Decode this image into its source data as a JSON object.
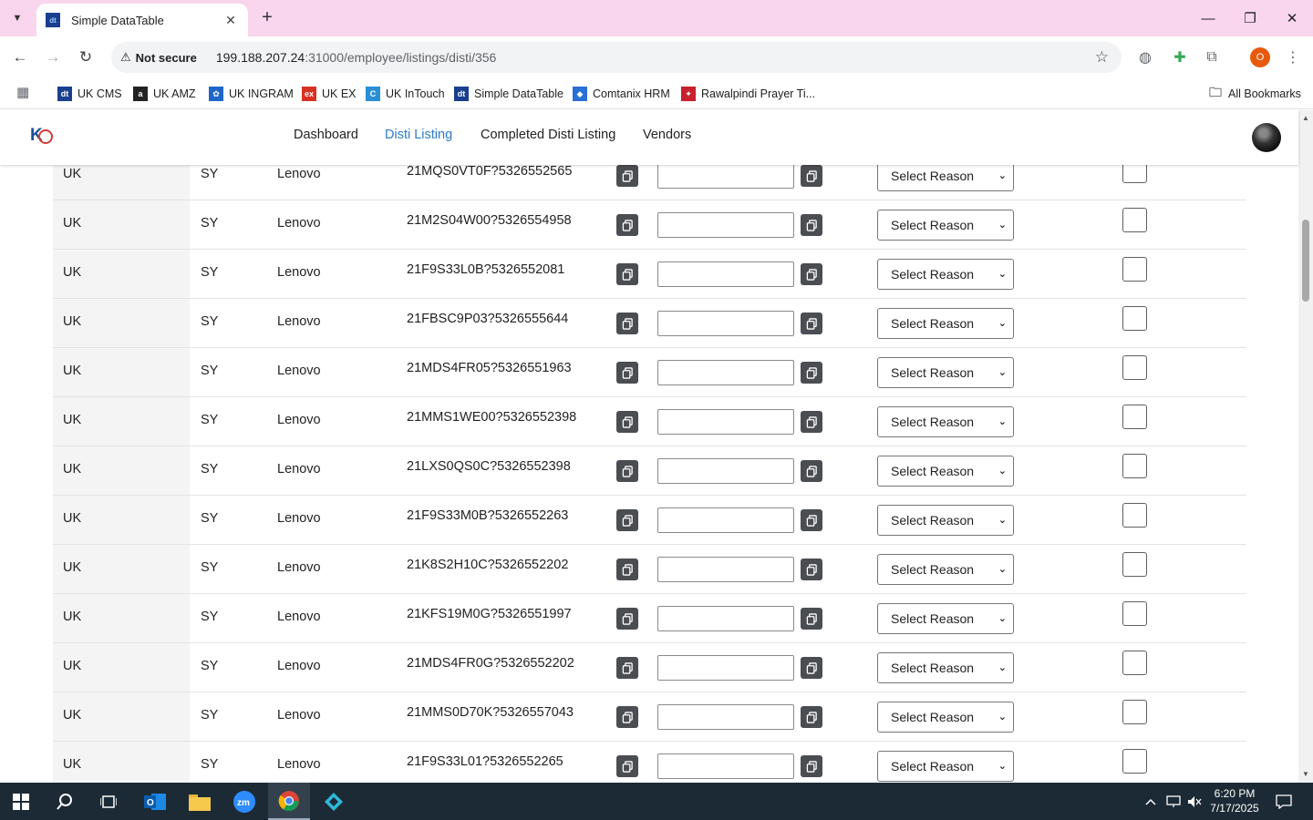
{
  "browser": {
    "tab_title": "Simple DataTable",
    "tab_favicon_text": "dt",
    "not_secure_label": "Not secure",
    "url_host": "199.188.207.24",
    "url_rest": ":31000/employee/listings/disti/356",
    "profile_initial": "O"
  },
  "bookmarks": [
    {
      "label": "UK CMS",
      "icon_text": "dt",
      "color": "#1a3f8f"
    },
    {
      "label": "UK AMZ",
      "icon_text": "a",
      "color": "#222222"
    },
    {
      "label": "UK INGRAM",
      "icon_text": "✿",
      "color": "#1e66c9"
    },
    {
      "label": "UK EX",
      "icon_text": "ex",
      "color": "#d93025"
    },
    {
      "label": "UK InTouch",
      "icon_text": "C",
      "color": "#2a8fd6"
    },
    {
      "label": "Simple DataTable",
      "icon_text": "dt",
      "color": "#1a3f8f"
    },
    {
      "label": "Comtanix HRM",
      "icon_text": "◆",
      "color": "#2a6fd6"
    },
    {
      "label": "Rawalpindi Prayer Ti...",
      "icon_text": "✦",
      "color": "#c8202c"
    }
  ],
  "all_bookmarks_label": "All Bookmarks",
  "nav": {
    "links": [
      "Dashboard",
      "Disti Listing",
      "Completed Disti Listing",
      "Vendors"
    ],
    "active": "Disti Listing"
  },
  "table": {
    "select_placeholder": "Select Reason",
    "rows": [
      {
        "country": "UK",
        "code": "SY",
        "brand": "Lenovo",
        "sku": "21MQS0VT0F?5326552565"
      },
      {
        "country": "UK",
        "code": "SY",
        "brand": "Lenovo",
        "sku": "21M2S04W00?5326554958"
      },
      {
        "country": "UK",
        "code": "SY",
        "brand": "Lenovo",
        "sku": "21F9S33L0B?5326552081"
      },
      {
        "country": "UK",
        "code": "SY",
        "brand": "Lenovo",
        "sku": "21FBSC9P03?5326555644"
      },
      {
        "country": "UK",
        "code": "SY",
        "brand": "Lenovo",
        "sku": "21MDS4FR05?5326551963"
      },
      {
        "country": "UK",
        "code": "SY",
        "brand": "Lenovo",
        "sku": "21MMS1WE00?5326552398"
      },
      {
        "country": "UK",
        "code": "SY",
        "brand": "Lenovo",
        "sku": "21LXS0QS0C?5326552398"
      },
      {
        "country": "UK",
        "code": "SY",
        "brand": "Lenovo",
        "sku": "21F9S33M0B?5326552263"
      },
      {
        "country": "UK",
        "code": "SY",
        "brand": "Lenovo",
        "sku": "21K8S2H10C?5326552202"
      },
      {
        "country": "UK",
        "code": "SY",
        "brand": "Lenovo",
        "sku": "21KFS19M0G?5326551997"
      },
      {
        "country": "UK",
        "code": "SY",
        "brand": "Lenovo",
        "sku": "21MDS4FR0G?5326552202"
      },
      {
        "country": "UK",
        "code": "SY",
        "brand": "Lenovo",
        "sku": "21MMS0D70K?5326557043"
      },
      {
        "country": "UK",
        "code": "SY",
        "brand": "Lenovo",
        "sku": "21F9S33L01?5326552265"
      }
    ]
  },
  "taskbar": {
    "time": "6:20 PM",
    "date": "7/17/2025"
  }
}
